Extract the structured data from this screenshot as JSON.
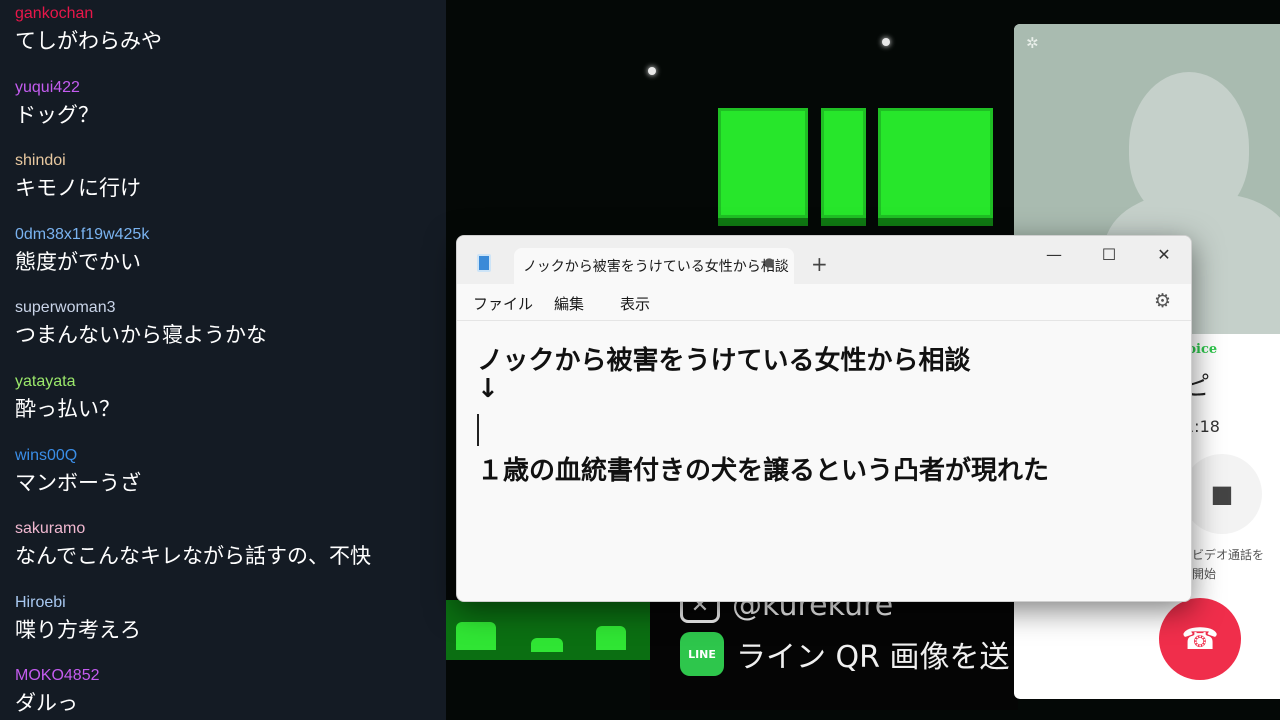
{
  "chat": {
    "messages": [
      {
        "user": "gankochan",
        "text": "てしがわらみや",
        "color": "#e8174a"
      },
      {
        "user": "yuqui422",
        "text": "ドッグ？",
        "color": "#c45cf0"
      },
      {
        "user": "shindoi",
        "text": "キモノに行け",
        "color": "#e9c9a0"
      },
      {
        "user": "0dm38x1f19w425k",
        "text": "態度がでかい",
        "color": "#7ab3f0"
      },
      {
        "user": "superwoman3",
        "text": "つまんないから寝ようかな",
        "color": "#c9d4e8"
      },
      {
        "user": "yatayata",
        "text": "酔っ払い？",
        "color": "#9be86b"
      },
      {
        "user": "wins00Q",
        "text": "マンボーうざ",
        "color": "#3a8ee8"
      },
      {
        "user": "sakuramo",
        "text": "なんでこんなキレながら話すの、不快",
        "color": "#f0b8d0"
      },
      {
        "user": "Hiroebi",
        "text": "喋り方考えろ",
        "color": "#a8c8f0"
      },
      {
        "user": "MOKO4852",
        "text": "ダルっ",
        "color": "#c45cf0"
      }
    ]
  },
  "notepad": {
    "tab_title": "ノックから被害をうけている女性から相談",
    "unsaved_indicator": "●",
    "new_tab": "+",
    "window": {
      "minimize": "—",
      "maximize": "☐",
      "close": "✕"
    },
    "menu": {
      "file": "ファイル",
      "edit": "編集",
      "view": "表示"
    },
    "lines": [
      "ノックから被害をうけている女性から相談",
      "↓",
      "",
      "１歳の血統書付きの犬を譲るという凸者が現れた"
    ]
  },
  "call": {
    "label": "D voice",
    "name": "ピ",
    "timer": "1:18",
    "video_caption_1": "ビデオ通話を",
    "video_caption_2": "開始",
    "accent": "#2ec64c",
    "hangup_color": "#f02e4b"
  },
  "stream": {
    "banner_x": "@kurekure",
    "banner_line": "ライン QR 画像を送っ"
  }
}
